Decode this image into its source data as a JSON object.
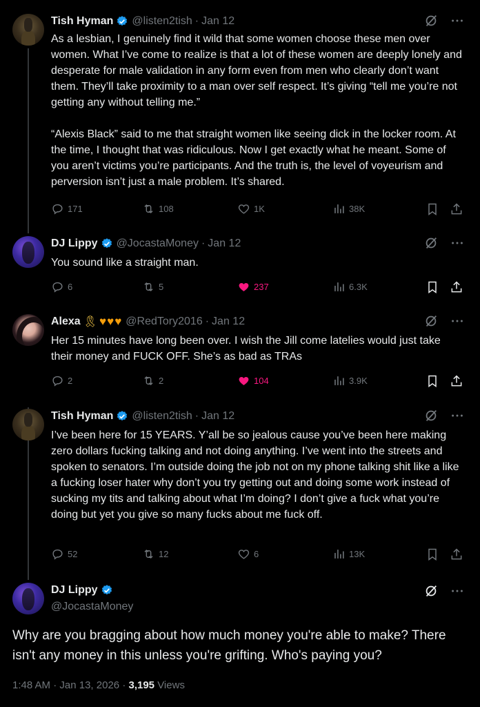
{
  "tweets": [
    {
      "name": "Tish Hyman",
      "handle": "@listen2tish",
      "date": "Jan 12",
      "text": "As a lesbian, I genuinely find it wild that some women choose these men over women. What I’ve come to realize is that a lot of these women are deeply lonely and desperate for male validation in any form even from men who clearly don’t want them. They’ll take proximity to a man over self respect. It’s giving “tell me you’re not getting any without telling me.”\n\n“Alexis Black” said to me that straight women like seeing dick in the locker room. At the time, I thought that was ridiculous. Now I get exactly what he meant. Some of you aren’t victims you’re participants. And the truth is, the level of voyeurism and perversion isn’t just a male problem. It’s shared.",
      "replies": "171",
      "reposts": "108",
      "likes": "1K",
      "views": "38K",
      "liked": false
    },
    {
      "name": "DJ Lippy",
      "handle": "@JocastaMoney",
      "date": "Jan 12",
      "text": "You sound like a straight man.",
      "replies": "6",
      "reposts": "5",
      "likes": "237",
      "views": "6.3K",
      "liked": true
    },
    {
      "name": "Alexa",
      "name_emoji": "🎗",
      "name_hearts": "♥♥♥",
      "handle": "@RedTory2016",
      "date": "Jan 12",
      "text": "Her 15 minutes have long been over. I wish the Jill come latelies would just take their money and FUCK OFF. She’s as bad as TRAs",
      "replies": "2",
      "reposts": "2",
      "likes": "104",
      "views": "3.9K",
      "liked": true
    },
    {
      "name": "Tish Hyman",
      "handle": "@listen2tish",
      "date": "Jan 12",
      "text": "I’ve been here for 15 YEARS. Y’all be so jealous cause you’ve been here making zero dollars fucking talking and not doing anything. I’ve went into the streets and spoken to senators. I’m outside doing the job not on my phone talking shit like a like a fucking loser hater why don’t you try getting out and doing some work instead of sucking my tits and talking about what I’m doing? I don’t give a fuck what you’re doing but yet you give so many fucks about me fuck off.",
      "replies": "52",
      "reposts": "12",
      "likes": "6",
      "views": "13K",
      "liked": false
    }
  ],
  "main_tweet": {
    "name": "DJ Lippy",
    "handle": "@JocastaMoney",
    "text": "Why are you bragging about how much money you're able to make? There isn't any money in this unless you're grifting. Who's paying you?",
    "time": "1:48 AM",
    "date": "Jan 13, 2026",
    "views_count": "3,195",
    "views_label": "Views"
  },
  "colors": {
    "background": "#000000",
    "text": "#e7e9ea",
    "muted": "#71767b",
    "like": "#f91880",
    "verified": "#1d9bf0"
  }
}
